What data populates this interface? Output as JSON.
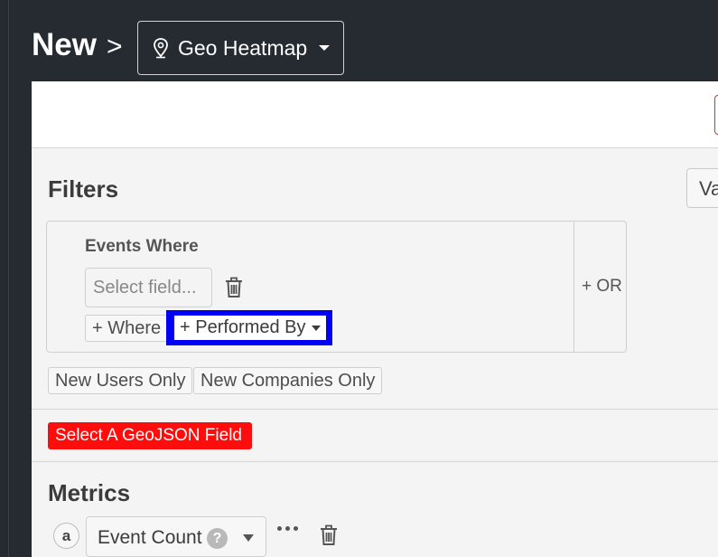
{
  "header": {
    "title": "New",
    "separator": ">",
    "chart_type": "Geo Heatmap"
  },
  "toolbar": {
    "va_label": "Va"
  },
  "filters": {
    "title": "Filters",
    "group_label": "Events Where",
    "field_placeholder": "Select field...",
    "where_button": "+ Where",
    "performed_by_button": "+ Performed By",
    "or_button": "+ OR",
    "new_users_only": "New Users Only",
    "new_companies_only": "New Companies Only"
  },
  "geojson_button": "Select A GeoJSON Field",
  "metrics": {
    "title": "Metrics",
    "items": [
      {
        "letter": "a",
        "name": "Event Count",
        "help": "?"
      }
    ]
  },
  "colors": {
    "page_bg": "#262b31",
    "panel_bg": "#f4f4f4",
    "highlight": "#0000f5",
    "geojson_button": "#ff0d0d"
  }
}
